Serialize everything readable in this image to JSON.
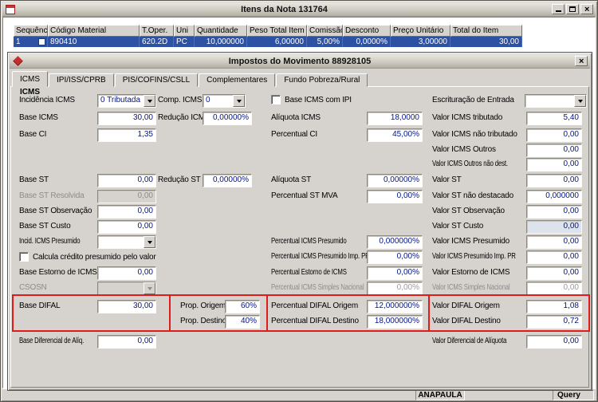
{
  "items_window": {
    "title": "Itens da Nota 131764",
    "table": {
      "columns": [
        "Sequência",
        "Código Material",
        "T.Oper.",
        "Uni",
        "Quantidade",
        "Peso Total Item",
        "Comissão",
        "Desconto",
        "Preço Unitário",
        "Total do Item"
      ],
      "row": {
        "seq": "1",
        "codigo_material": "890410",
        "t_oper": "620.2D",
        "uni": "PC",
        "quantidade": "10,000000",
        "peso_total_item": "6,00000",
        "comissao": "5,00%",
        "desconto": "0,0000%",
        "preco_unitario": "3,00000",
        "total_do_item": "30,00"
      }
    }
  },
  "modal": {
    "title": "Impostos do Movimento 88928105",
    "tabs": [
      "ICMS",
      "IPI/ISS/CPRB",
      "PIS/COFINS/CSLL",
      "Complementares",
      "Fundo Pobreza/Rural"
    ],
    "active_tab": "ICMS",
    "group_label": "ICMS",
    "fields": {
      "incidencia_icms": {
        "label": "Incidência ICMS",
        "value": "0 Tributada"
      },
      "comp_icms": {
        "label": "Comp. ICMS",
        "value": "0"
      },
      "base_icms_com_ipi": {
        "label": "Base ICMS com IPI",
        "checked": false
      },
      "escrituracao_entrada": {
        "label": "Escrituração de Entrada",
        "value": ""
      },
      "base_icms": {
        "label": "Base ICMS",
        "value": "30,00"
      },
      "reducao_icms": {
        "label": "Redução ICMS",
        "value": "0,00000%"
      },
      "aliquota_icms": {
        "label": "Alíquota ICMS",
        "value": "18,0000"
      },
      "valor_icms_tributado": {
        "label": "Valor ICMS tributado",
        "value": "5,40"
      },
      "base_ci": {
        "label": "Base CI",
        "value": "1,35"
      },
      "percentual_ci": {
        "label": "Percentual CI",
        "value": "45,00%"
      },
      "valor_icms_nao_tributado": {
        "label": "Valor ICMS não tributado",
        "value": "0,00"
      },
      "valor_icms_outros": {
        "label": "Valor ICMS Outros",
        "value": "0,00"
      },
      "valor_icms_outros_nao_dest": {
        "label": "Valor ICMS Outros não dest.",
        "value": "0,00"
      },
      "base_st": {
        "label": "Base ST",
        "value": "0,00"
      },
      "reducao_st": {
        "label": "Redução ST",
        "value": "0,00000%"
      },
      "aliquota_st": {
        "label": "Alíquota ST",
        "value": "0,00000%"
      },
      "valor_st": {
        "label": "Valor ST",
        "value": "0,00"
      },
      "base_st_resolvida": {
        "label": "Base ST Resolvida",
        "value": "0,00"
      },
      "percentual_st_mva": {
        "label": "Percentual ST MVA",
        "value": "0,00%"
      },
      "valor_st_nao_destacado": {
        "label": "Valor ST não destacado",
        "value": "0,000000"
      },
      "base_st_observacao": {
        "label": "Base ST Observação",
        "value": "0,00"
      },
      "valor_st_observacao": {
        "label": "Valor ST Observação",
        "value": "0,00"
      },
      "base_st_custo": {
        "label": "Base ST Custo",
        "value": "0,00"
      },
      "valor_st_custo": {
        "label": "Valor ST Custo",
        "value": "0,00"
      },
      "incid_icms_presumido": {
        "label": "Incid. ICMS Presumido",
        "value": ""
      },
      "percentual_icms_presumido": {
        "label": "Percentual ICMS Presumido",
        "value": "0,000000%"
      },
      "valor_icms_presumido": {
        "label": "Valor ICMS Presumido",
        "value": "0,00"
      },
      "calcula_credito_presumido": {
        "label": "Calcula crédito presumido pelo valor",
        "checked": false
      },
      "percentual_icms_presumido_imp_pr": {
        "label": "Percentual ICMS Presumido Imp. PR",
        "value": "0,00%"
      },
      "valor_icms_presumido_imp_pr": {
        "label": "Valor ICMS Presumido Imp. PR",
        "value": "0,00"
      },
      "base_estorno_icms": {
        "label": "Base Estorno de ICMS",
        "value": "0,00"
      },
      "percentual_estorno_icms": {
        "label": "Percentual Estorno de ICMS",
        "value": "0,00%"
      },
      "valor_estorno_icms": {
        "label": "Valor Estorno de ICMS",
        "value": "0,00"
      },
      "csosn": {
        "label": "CSOSN",
        "value": ""
      },
      "percentual_icms_simples_nacional": {
        "label": "Percentual ICMS Simples Nacional",
        "value": "0,00%"
      },
      "valor_icms_simples_nacional": {
        "label": "Valor ICMS Simples Nacional",
        "value": "0,00"
      },
      "base_difal": {
        "label": "Base DIFAL",
        "value": "30,00"
      },
      "prop_origem": {
        "label": "Prop. Origem",
        "value": "60%"
      },
      "percentual_difal_origem": {
        "label": "Percentual DIFAL Origem",
        "value": "12,000000%"
      },
      "valor_difal_origem": {
        "label": "Valor DIFAL Origem",
        "value": "1,08"
      },
      "prop_destino": {
        "label": "Prop. Destino",
        "value": "40%"
      },
      "percentual_difal_destino": {
        "label": "Percentual DIFAL Destino",
        "value": "18,000000%"
      },
      "valor_difal_destino": {
        "label": "Valor DIFAL Destino",
        "value": "0,72"
      },
      "base_diferencial_aliq": {
        "label": "Base Diferencial de Alíq.",
        "value": "0,00"
      },
      "valor_diferencial_aliquota": {
        "label": "Valor Diferencial de Alíquota",
        "value": "0,00"
      }
    }
  },
  "statusbar": {
    "user": "ANAPAULA",
    "mode": "Query"
  },
  "colors": {
    "selection_blue": "#2d51a3",
    "value_text": "#001489",
    "annotation_red": "#e01b1b",
    "chrome_gray": "#d6d3ce"
  }
}
